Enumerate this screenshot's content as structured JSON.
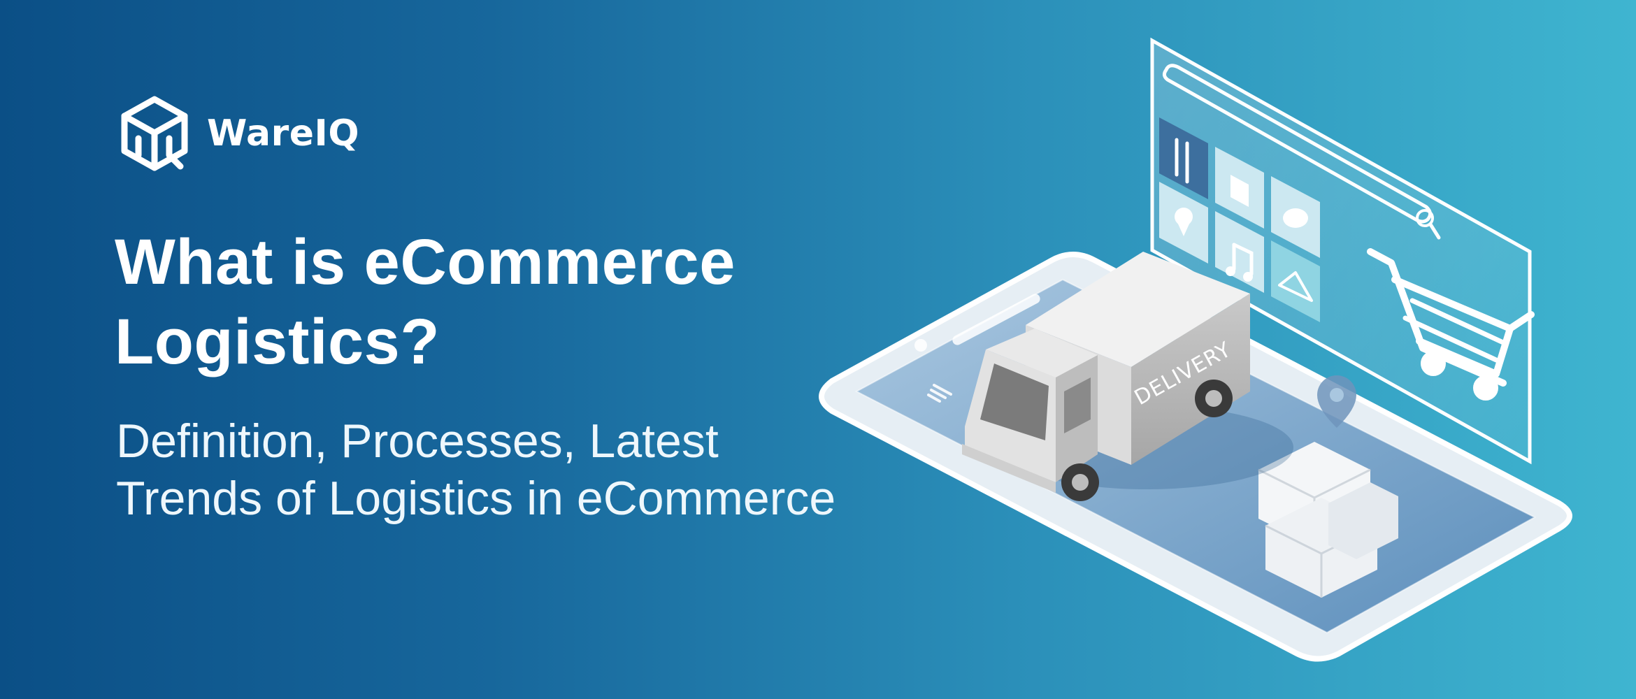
{
  "brand": {
    "name": "WareIQ",
    "logo_icon": "wareiq-cube-logo-icon"
  },
  "headline": {
    "line1": "What is eCommerce",
    "line2": "Logistics?"
  },
  "subheadline": {
    "line1": "Definition, Processes, Latest",
    "line2": "Trends of Logistics in eCommerce"
  },
  "illustration": {
    "truck_label": "DELIVERY",
    "app_icons": [
      "fork-knife-icon",
      "shopping-bag-icon",
      "location-pin-icon",
      "music-note-icon",
      "burger-icon",
      "hanger-icon"
    ],
    "icons": [
      "search-icon",
      "shopping-cart-icon",
      "location-pin-icon",
      "package-boxes-icon",
      "delivery-truck-icon",
      "smartphone-icon"
    ]
  },
  "colors": {
    "gradient_start": "#0b4f86",
    "gradient_end": "#3fb5d0",
    "text": "#ffffff",
    "tile_dark": "#3d6f9e",
    "tile_light": "#d9eef5",
    "tile_teal": "#8fd4e2"
  }
}
